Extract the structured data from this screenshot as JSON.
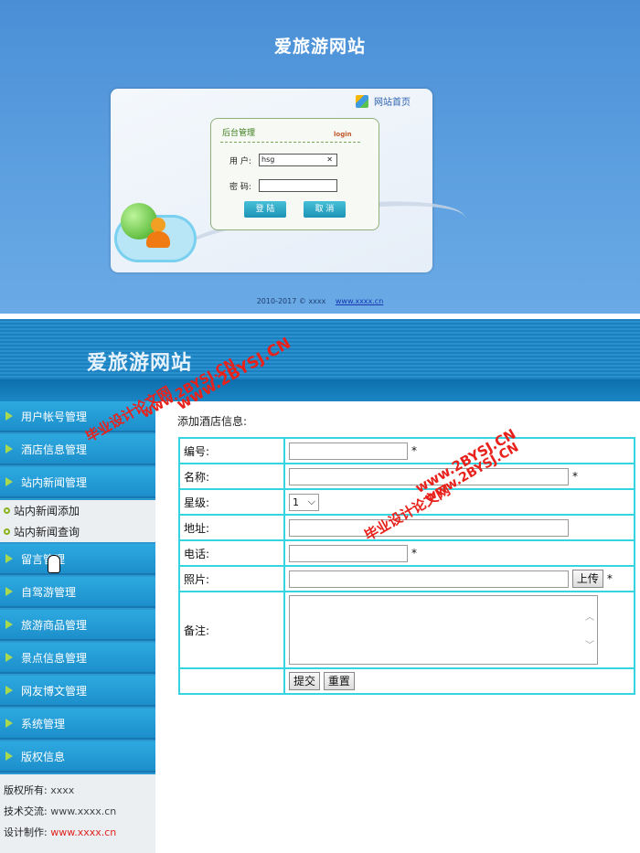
{
  "login_page": {
    "site_title": "爱旅游网站",
    "home_link": "网站首页",
    "box_title": "后台管理",
    "box_login": "login",
    "username_label": "用  户:",
    "username_value": "hsg",
    "clear_icon": "✕",
    "password_label": "密  码:",
    "login_button": "登 陆",
    "cancel_button": "取 消",
    "footer_copyright": "2010-2017 ©   xxxx",
    "footer_link": "www.xxxx.cn"
  },
  "admin_page": {
    "site_title": "爱旅游网站",
    "menu": [
      "用户帐号管理",
      "酒店信息管理",
      "站内新闻管理",
      "留言管理",
      "自驾游管理",
      "旅游商品管理",
      "景点信息管理",
      "网友博文管理",
      "系统管理",
      "版权信息"
    ],
    "submenu": [
      "站内新闻添加",
      "站内新闻查询"
    ],
    "info": {
      "copyright_label": "版权所有:",
      "copyright_value": "xxxx",
      "tech_label": "技术交流:",
      "tech_value": "www.xxxx.cn",
      "design_label": "设计制作:",
      "design_value": "www.xxxx.cn"
    },
    "form": {
      "title": "添加酒店信息:",
      "fields": {
        "number": "编号:",
        "name": "名称:",
        "star": "星级:",
        "address": "地址:",
        "phone": "电话:",
        "photo": "照片:",
        "remark": "备注:"
      },
      "required_mark": "*",
      "star_value": "1",
      "upload_button": "上传",
      "submit_button": "提交",
      "reset_button": "重置"
    }
  },
  "watermarks": {
    "text_a": "www.2BYSJ.CN",
    "text_b": "毕业设计论文网"
  },
  "colors": {
    "header_blue": "#1c7fc0",
    "menu_blue": "#2ea9e0",
    "table_border": "#36d4e0",
    "watermark_red": "#e8211b"
  }
}
